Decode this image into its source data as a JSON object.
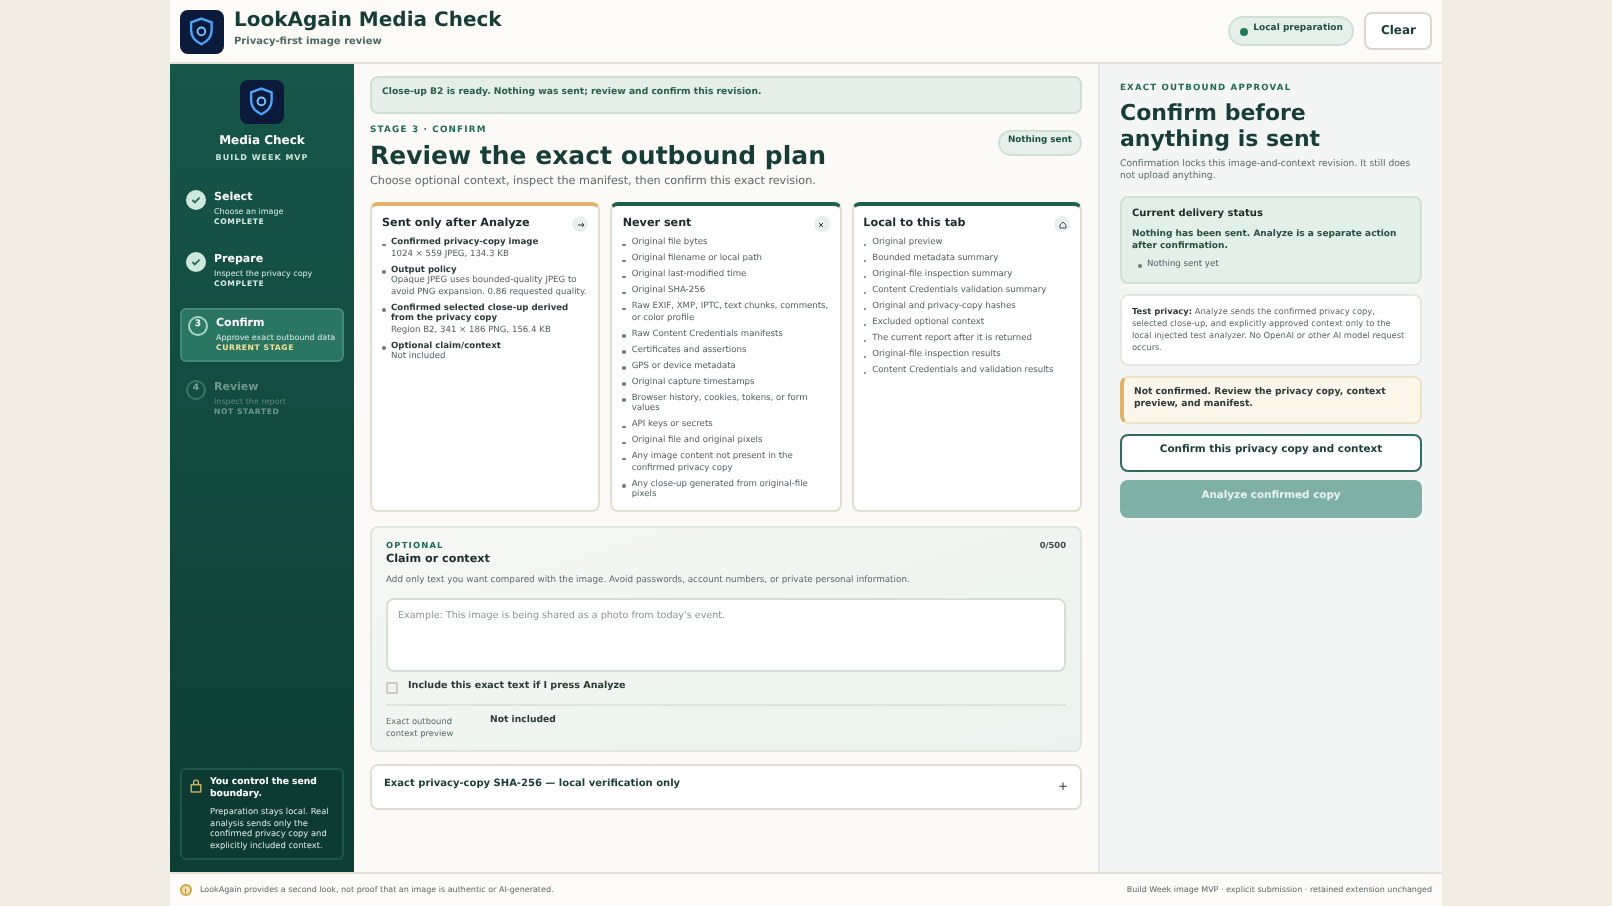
{
  "header": {
    "title": "LookAgain Media Check",
    "subtitle": "Privacy-first image review",
    "status_pill": "Local preparation",
    "clear_button": "Clear"
  },
  "sidebar": {
    "title": "Media Check",
    "subtitle": "BUILD WEEK MVP",
    "steps": [
      {
        "title": "Select",
        "description": "Choose an image",
        "status_label": "COMPLETE",
        "kind": "complete"
      },
      {
        "title": "Prepare",
        "description": "Inspect the privacy copy",
        "status_label": "COMPLETE",
        "kind": "complete"
      },
      {
        "number": "3",
        "title": "Confirm",
        "description": "Approve exact outbound data",
        "status_label": "CURRENT STAGE",
        "kind": "current"
      },
      {
        "number": "4",
        "title": "Review",
        "description": "Inspect the report",
        "status_label": "NOT STARTED",
        "kind": "pending"
      }
    ],
    "notice": {
      "title": "You control the send boundary.",
      "body": "Preparation stays local. Real analysis sends only the confirmed privacy copy and explicitly included context."
    }
  },
  "main": {
    "banner": "Close-up B2 is ready. Nothing was sent; review and confirm this revision.",
    "eyebrow": "STAGE 3 · CONFIRM",
    "title": "Review the exact outbound plan",
    "badge": "Nothing sent",
    "intro": "Choose optional context, inspect the manifest, then confirm this exact revision.",
    "columns": [
      {
        "kind": "send",
        "title": "Sent only after Analyze",
        "items": [
          {
            "label": "Confirmed privacy-copy image",
            "detail": "1024 × 559 JPEG, 134.3 KB"
          },
          {
            "label": "Output policy",
            "detail": "Opaque JPEG uses bounded-quality JPEG to avoid PNG expansion. 0.86 requested quality."
          },
          {
            "label": "Confirmed selected close-up derived from the privacy copy",
            "detail": "Region B2, 341 × 186 PNG, 156.4 KB"
          },
          {
            "label": "Optional claim/context",
            "detail": "Not included"
          }
        ]
      },
      {
        "kind": "never",
        "title": "Never sent",
        "items": [
          {
            "label": "Original file bytes"
          },
          {
            "label": "Original filename or local path"
          },
          {
            "label": "Original last-modified time"
          },
          {
            "label": "Original SHA-256"
          },
          {
            "label": "Raw EXIF, XMP, IPTC, text chunks, comments, or color profile"
          },
          {
            "label": "Raw Content Credentials manifests"
          },
          {
            "label": "Certificates and assertions"
          },
          {
            "label": "GPS or device metadata"
          },
          {
            "label": "Original capture timestamps"
          },
          {
            "label": "Browser history, cookies, tokens, or form values"
          },
          {
            "label": "API keys or secrets"
          },
          {
            "label": "Original file and original pixels"
          },
          {
            "label": "Any image content not present in the confirmed privacy copy"
          },
          {
            "label": "Any close-up generated from original-file pixels"
          }
        ]
      },
      {
        "kind": "local",
        "title": "Local to this tab",
        "items": [
          {
            "label": "Original preview"
          },
          {
            "label": "Bounded metadata summary"
          },
          {
            "label": "Original-file inspection summary"
          },
          {
            "label": "Content Credentials validation summary"
          },
          {
            "label": "Original and privacy-copy hashes"
          },
          {
            "label": "Excluded optional context"
          },
          {
            "label": "The current report after it is returned"
          },
          {
            "label": "Original-file inspection results"
          },
          {
            "label": "Content Credentials and validation results"
          }
        ]
      }
    ],
    "context": {
      "eyebrow": "OPTIONAL",
      "title": "Claim or context",
      "count": "0/500",
      "hint": "Add only text you want compared with the image. Avoid passwords, account numbers, or private personal information.",
      "placeholder": "Example: This image is being shared as a photo from today's event.",
      "include_label": "Include this exact text if I press Analyze",
      "include_checked": false,
      "preview_label": "Exact outbound context preview",
      "preview_value": "Not included"
    },
    "hash_section": {
      "title": "Exact privacy-copy SHA-256 — local verification only",
      "toggle": "+"
    }
  },
  "panel": {
    "eyebrow": "EXACT OUTBOUND APPROVAL",
    "title": "Confirm before anything is sent",
    "intro": "Confirmation locks this image-and-context revision. It still does not upload anything.",
    "status": {
      "title": "Current delivery status",
      "message": "Nothing has been sent. Analyze is a separate action after confirmation.",
      "items": [
        "Nothing sent yet"
      ]
    },
    "test_note": {
      "label": "Test privacy:",
      "body": "Analyze sends the confirmed privacy copy, selected close-up, and explicitly approved context only to the local injected test analyzer. No OpenAI or other AI model request occurs."
    },
    "warning": "Not confirmed. Review the privacy copy, context preview, and manifest.",
    "confirm_button": {
      "label": "Confirm this privacy copy and context",
      "disabled": false
    },
    "analyze_button": {
      "label": "Analyze confirmed copy",
      "disabled": true
    }
  },
  "footer": {
    "disclaimer": "LookAgain provides a second look, not proof that an image is authentic or AI-generated.",
    "build": "Build Week image MVP · explicit submission · retained extension unchanged"
  }
}
